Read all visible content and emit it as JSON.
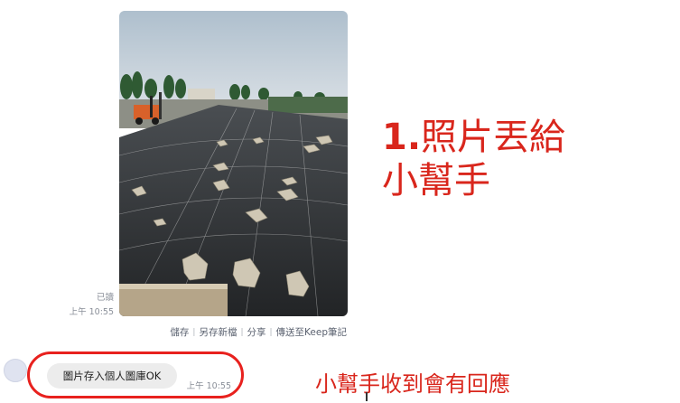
{
  "chat": {
    "image_message": {
      "read_label": "已讀",
      "time": "上午 10:55"
    },
    "image_actions": [
      "儲存",
      "另存新檔",
      "分享",
      "傳送至Keep筆記"
    ],
    "reply": {
      "text": "圖片存入個人圖庫OK",
      "time": "上午 10:55"
    }
  },
  "annotations": {
    "step_number": "1.",
    "step_text_line1": "照片丟給",
    "step_text_line2": "小幫手",
    "reply_note": "小幫手收到會有回應"
  },
  "colors": {
    "annotation_red": "#d9261c",
    "highlight_ring": "#e8211e",
    "bubble_bg": "#ececec"
  }
}
